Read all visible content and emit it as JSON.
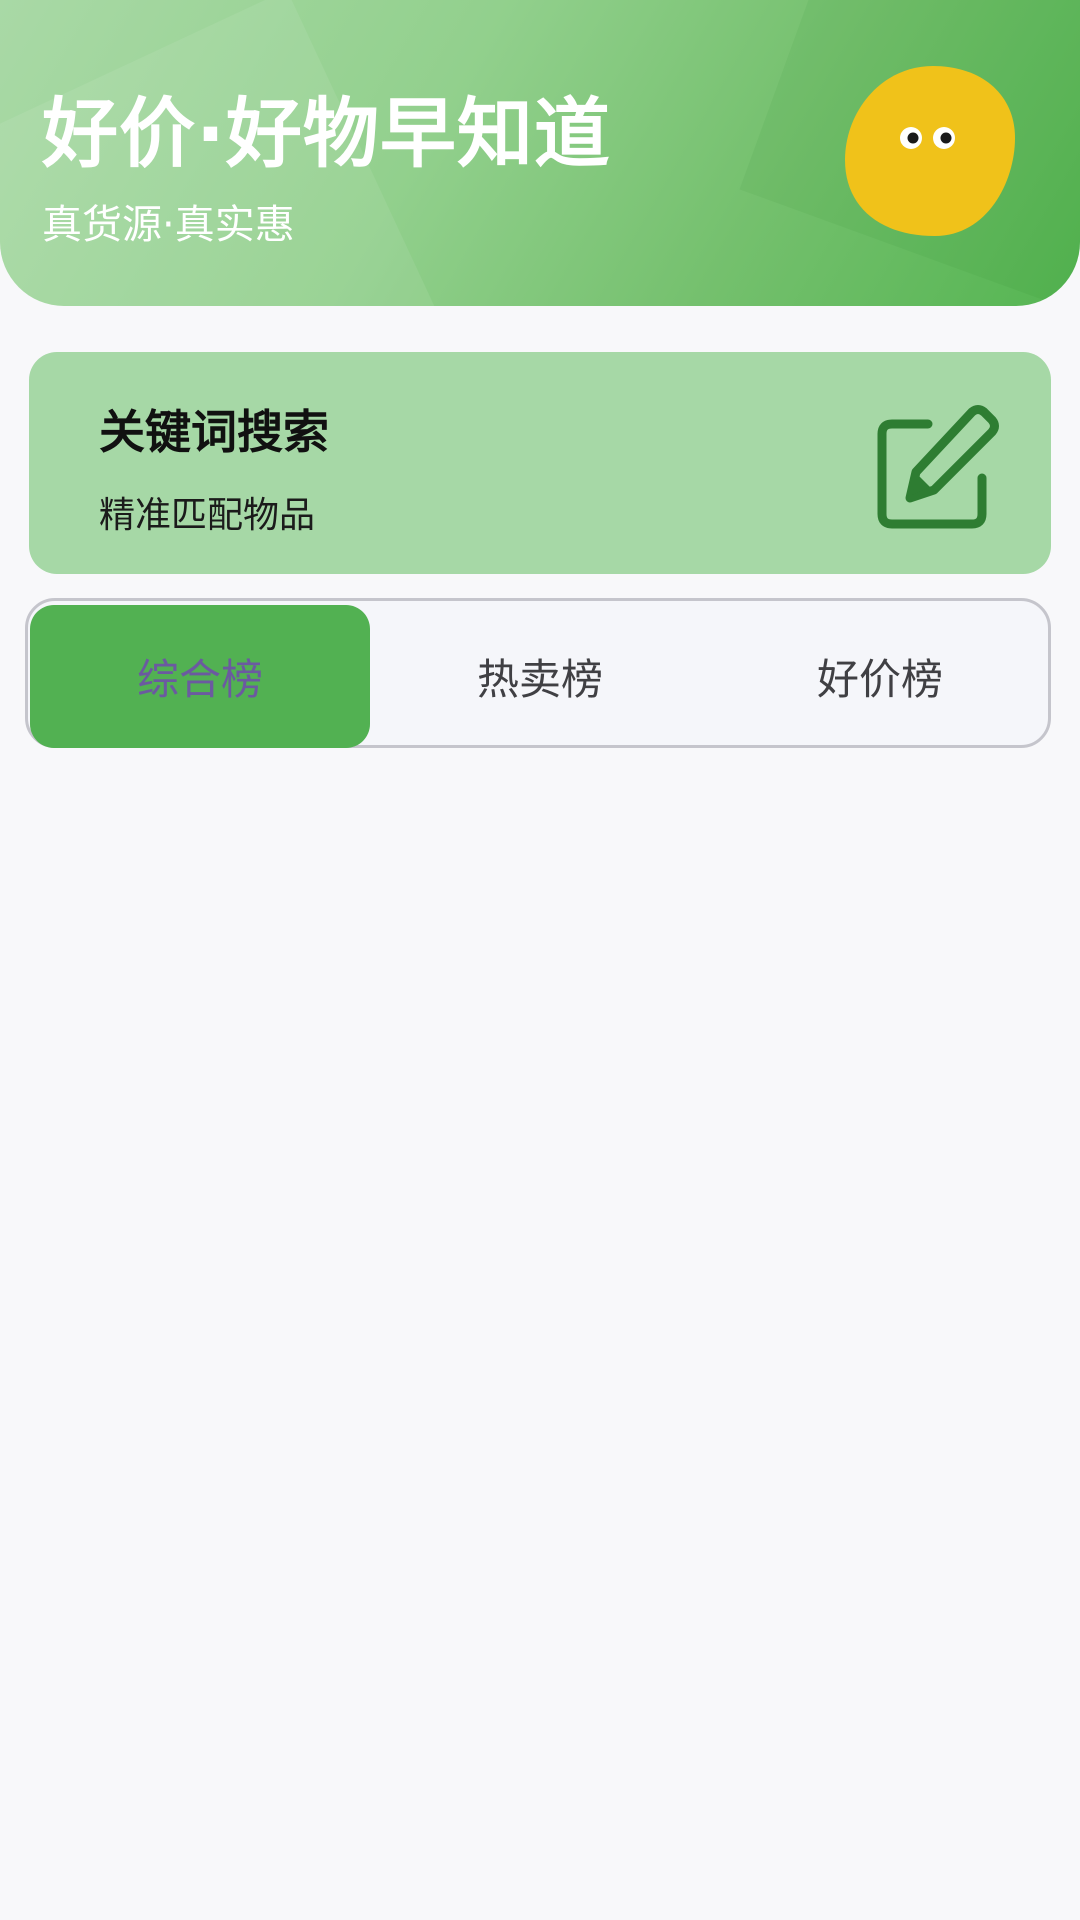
{
  "header": {
    "title": "好价·好物早知道",
    "subtitle": "真货源·真实惠",
    "mascot_icon": "yellow-blob-mascot"
  },
  "search_card": {
    "title": "关键词搜索",
    "description": "精准匹配物品",
    "icon": "edit-icon"
  },
  "tabs": [
    {
      "label": "综合榜",
      "active": true
    },
    {
      "label": "热卖榜",
      "active": false
    },
    {
      "label": "好价榜",
      "active": false
    }
  ],
  "colors": {
    "accent_green": "#52b152",
    "card_green": "#a6d8a6",
    "icon_dark_green": "#2e7d32",
    "mascot_yellow": "#f0c21a",
    "active_tab_text": "#6b5aa0"
  }
}
